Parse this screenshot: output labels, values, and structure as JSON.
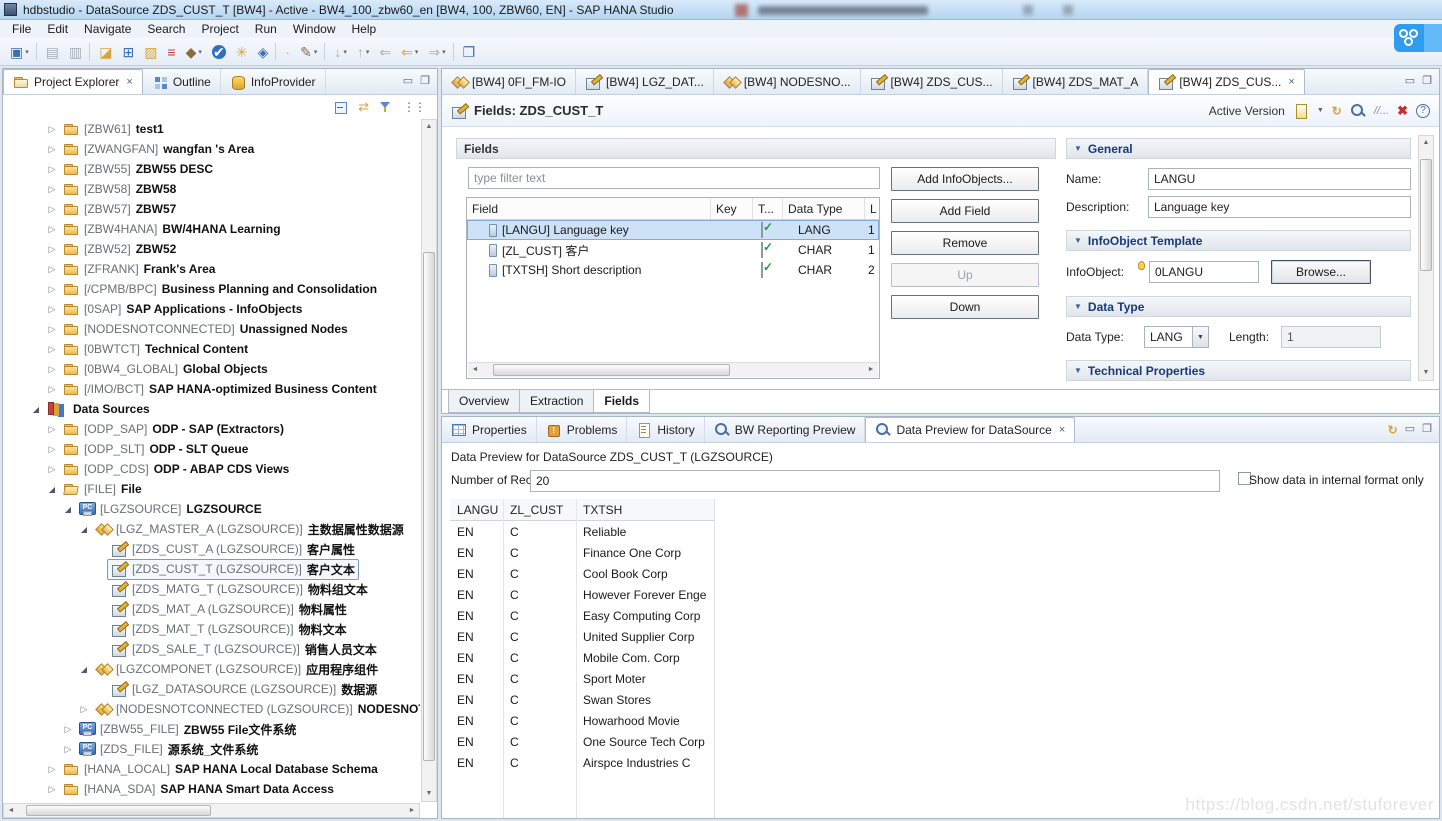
{
  "window": {
    "title": "hdbstudio - DataSource ZDS_CUST_T [BW4] - Active - BW4_100_zbw60_en [BW4, 100, ZBW60, EN] - SAP HANA Studio"
  },
  "menu": [
    "File",
    "Edit",
    "Navigate",
    "Search",
    "Project",
    "Run",
    "Window",
    "Help"
  ],
  "toolbar": [
    {
      "g": "▣",
      "c": "c-blue",
      "dd": "▾"
    },
    {
      "cls": "sep"
    },
    {
      "g": "▤",
      "c": "c-gray"
    },
    {
      "g": "▥",
      "c": "c-gray"
    },
    {
      "cls": "sep"
    },
    {
      "g": "◪",
      "c": "c-gold"
    },
    {
      "g": "⊞",
      "c": "c-blue"
    },
    {
      "g": "▨",
      "c": "c-gold"
    },
    {
      "g": "≡",
      "c": "c-red"
    },
    {
      "g": "◆",
      "c": "c-olive",
      "dd": "▾"
    },
    {
      "g": "✔",
      "c": "c-check"
    },
    {
      "g": "✳",
      "c": "c-gold"
    },
    {
      "g": "◈",
      "c": "c-blue"
    },
    {
      "cls": "sep"
    },
    {
      "g": "·",
      "c": "c-gray"
    },
    {
      "g": "✎",
      "c": "c-olive",
      "dd": "▾"
    },
    {
      "cls": "sep"
    },
    {
      "g": "↓",
      "c": "c-gray",
      "dd": "▾"
    },
    {
      "g": "↑",
      "c": "c-gray",
      "dd": "▾"
    },
    {
      "g": "⇐",
      "c": "c-gray"
    },
    {
      "g": "⇐",
      "c": "c-gold",
      "dd": "▾"
    },
    {
      "g": "⇒",
      "c": "c-gray",
      "dd": "▾"
    },
    {
      "cls": "sep"
    },
    {
      "g": "❐",
      "c": "c-blue"
    }
  ],
  "left_panel": {
    "tabs": [
      {
        "icon": "explorer",
        "label": "Project Explorer",
        "cls": "active",
        "close": "×"
      },
      {
        "icon": "outline",
        "label": "Outline"
      },
      {
        "icon": "infoprov",
        "label": "InfoProvider"
      }
    ],
    "tree": [
      {
        "id": "[ZBW61]",
        "label": "test1",
        "icon": "infoarea",
        "ar": "c",
        "lvl": 2
      },
      {
        "id": "[ZWANGFAN]",
        "label": "wangfan 's Area",
        "icon": "infoarea",
        "ar": "c",
        "lvl": 2
      },
      {
        "id": "[ZBW55]",
        "label": "ZBW55 DESC",
        "icon": "infoarea",
        "ar": "c",
        "lvl": 2
      },
      {
        "id": "[ZBW58]",
        "label": "ZBW58",
        "icon": "infoarea",
        "ar": "c",
        "lvl": 2
      },
      {
        "id": "[ZBW57]",
        "label": "ZBW57",
        "icon": "infoarea",
        "ar": "c",
        "lvl": 2
      },
      {
        "id": "[ZBW4HANA]",
        "label": "BW/4HANA Learning",
        "icon": "infoarea",
        "ar": "c",
        "lvl": 2
      },
      {
        "id": "[ZBW52]",
        "label": "ZBW52",
        "icon": "infoarea",
        "ar": "c",
        "lvl": 2
      },
      {
        "id": "[ZFRANK]",
        "label": "Frank's Area",
        "icon": "infoarea",
        "ar": "c",
        "lvl": 2
      },
      {
        "id": "[/CPMB/BPC]",
        "label": "Business Planning and Consolidation",
        "icon": "infoarea",
        "ar": "c",
        "lvl": 2
      },
      {
        "id": "[0SAP]",
        "label": "SAP Applications - InfoObjects",
        "icon": "infoarea",
        "ar": "c",
        "lvl": 2
      },
      {
        "id": "[NODESNOTCONNECTED]",
        "label": "Unassigned Nodes",
        "icon": "infoarea",
        "ar": "c",
        "lvl": 2
      },
      {
        "id": "[0BWTCT]",
        "label": "Technical Content",
        "icon": "infoarea",
        "ar": "c",
        "lvl": 2
      },
      {
        "id": "[0BW4_GLOBAL]",
        "label": "Global Objects",
        "icon": "infoarea",
        "ar": "c",
        "lvl": 2
      },
      {
        "id": "[/IMO/BCT]",
        "label": "SAP HANA-optimized Business Content",
        "icon": "infoarea",
        "ar": "c",
        "lvl": 2
      },
      {
        "id": "",
        "label": "Data Sources",
        "icon": "books",
        "ar": "e",
        "lvl": 1
      },
      {
        "id": "[ODP_SAP]",
        "label": "ODP - SAP (Extractors)",
        "icon": "folder",
        "ar": "c",
        "lvl": 2
      },
      {
        "id": "[ODP_SLT]",
        "label": "ODP - SLT Queue",
        "icon": "folder",
        "ar": "c",
        "lvl": 2
      },
      {
        "id": "[ODP_CDS]",
        "label": "ODP - ABAP CDS Views",
        "icon": "folder",
        "ar": "c",
        "lvl": 2
      },
      {
        "id": "[FILE]",
        "label": "File",
        "icon": "folderopen",
        "ar": "e",
        "lvl": 2
      },
      {
        "id": "[LGZSOURCE]",
        "label": "LGZSOURCE",
        "icon": "pc",
        "ar": "e",
        "lvl": 3
      },
      {
        "id": "[LGZ_MASTER_A (LGZSOURCE)]",
        "label": "主数据属性数据源",
        "icon": "diamond",
        "ar": "e",
        "lvl": 4
      },
      {
        "id": "[ZDS_CUST_A (LGZSOURCE)]",
        "label": "客户属性",
        "icon": "ds",
        "ar": "n",
        "lvl": 5
      },
      {
        "id": "[ZDS_CUST_T (LGZSOURCE)]",
        "label": "客户文本",
        "icon": "ds",
        "ar": "n",
        "lvl": 5,
        "sel": "sel"
      },
      {
        "id": "[ZDS_MATG_T (LGZSOURCE)]",
        "label": "物料组文本",
        "icon": "ds",
        "ar": "n",
        "lvl": 5
      },
      {
        "id": "[ZDS_MAT_A (LGZSOURCE)]",
        "label": "物料属性",
        "icon": "ds",
        "ar": "n",
        "lvl": 5
      },
      {
        "id": "[ZDS_MAT_T (LGZSOURCE)]",
        "label": "物料文本",
        "icon": "ds",
        "ar": "n",
        "lvl": 5
      },
      {
        "id": "[ZDS_SALE_T (LGZSOURCE)]",
        "label": "销售人员文本",
        "icon": "ds",
        "ar": "n",
        "lvl": 5
      },
      {
        "id": "[LGZCOMPONET (LGZSOURCE)]",
        "label": "应用程序组件",
        "icon": "diamond",
        "ar": "e",
        "lvl": 4
      },
      {
        "id": "[LGZ_DATASOURCE (LGZSOURCE)]",
        "label": "数据源",
        "icon": "ds",
        "ar": "n",
        "lvl": 5
      },
      {
        "id": "[NODESNOTCONNECTED (LGZSOURCE)]",
        "label": "NODESNOTCONNECTED",
        "icon": "diamond",
        "ar": "c",
        "lvl": 4
      },
      {
        "id": "[ZBW55_FILE]",
        "label": "ZBW55 File文件系统",
        "icon": "pc",
        "ar": "c",
        "lvl": 3
      },
      {
        "id": "[ZDS_FILE]",
        "label": "源系统_文件系统",
        "icon": "pc",
        "ar": "c",
        "lvl": 3
      },
      {
        "id": "[HANA_LOCAL]",
        "label": "SAP HANA Local Database Schema",
        "icon": "folder",
        "ar": "c",
        "lvl": 2
      },
      {
        "id": "[HANA_SDA]",
        "label": "SAP HANA Smart Data Access",
        "icon": "folder",
        "ar": "c",
        "lvl": 2
      }
    ]
  },
  "editor": {
    "tabs": [
      {
        "icon": "diamond",
        "label": "[BW4] 0FI_FM-IO"
      },
      {
        "icon": "ds",
        "label": "[BW4] LGZ_DAT..."
      },
      {
        "icon": "diamond",
        "label": "[BW4] NODESNO..."
      },
      {
        "icon": "ds",
        "label": "[BW4] ZDS_CUS..."
      },
      {
        "icon": "ds",
        "label": "[BW4] ZDS_MAT_A"
      },
      {
        "icon": "ds",
        "label": "[BW4] ZDS_CUS...",
        "cls": "active",
        "close": "×"
      }
    ],
    "header": {
      "title": "Fields: ZDS_CUST_T",
      "active_version": "Active Version"
    },
    "fields_section": {
      "title": "Fields",
      "filter_placeholder": "type filter text",
      "columns": [
        "Field",
        "Key",
        "T...",
        "Data Type",
        "L"
      ],
      "rows": [
        {
          "field": "[LANGU] Language key",
          "type": "LANG",
          "len": "1",
          "sel": "sel"
        },
        {
          "field": "[ZL_CUST] 客户",
          "type": "CHAR",
          "len": "1"
        },
        {
          "field": "[TXTSH] Short description",
          "type": "CHAR",
          "len": "2"
        }
      ],
      "buttons": [
        {
          "label": "Add InfoObjects..."
        },
        {
          "label": "Add Field"
        },
        {
          "label": "Remove"
        },
        {
          "label": "Up",
          "cls": "dis"
        },
        {
          "label": "Down"
        }
      ]
    },
    "properties": {
      "general_title": "General",
      "name_label": "Name:",
      "name_value": "LANGU",
      "desc_label": "Description:",
      "desc_value": "Language key",
      "template_title": "InfoObject Template",
      "infoobject_label": "InfoObject:",
      "infoobject_value": "0LANGU",
      "browse_label": "Browse...",
      "datatype_title": "Data Type",
      "datatype_label": "Data Type:",
      "datatype_value": "LANG",
      "length_label": "Length:",
      "length_value": "1",
      "technical_title": "Technical Properties"
    },
    "page_tabs": [
      {
        "label": "Overview"
      },
      {
        "label": "Extraction"
      },
      {
        "label": "Fields",
        "cls": "active"
      }
    ]
  },
  "bottom_panel": {
    "tabs": [
      {
        "icon": "properties",
        "label": "Properties"
      },
      {
        "icon": "problems",
        "label": "Problems"
      },
      {
        "icon": "history",
        "label": "History"
      },
      {
        "icon": "mag",
        "label": "BW Reporting Preview"
      },
      {
        "icon": "mag",
        "label": "Data Preview for DataSource",
        "cls": "active",
        "close": "×"
      }
    ],
    "preview_title": "Data Preview for DataSource ZDS_CUST_T (LGZSOURCE)",
    "records_label": "Number of Records:",
    "records_value": "20",
    "internal_label": "Show data in internal format only",
    "table": {
      "columns": [
        "LANGU",
        "ZL_CUST",
        "TXTSH"
      ],
      "rows": [
        [
          "EN",
          "C",
          "Reliable"
        ],
        [
          "EN",
          "C",
          "Finance One Corp"
        ],
        [
          "EN",
          "C",
          "Cool Book Corp"
        ],
        [
          "EN",
          "C",
          "However Forever Enge"
        ],
        [
          "EN",
          "C",
          "Easy Computing Corp"
        ],
        [
          "EN",
          "C",
          "United Supplier Corp"
        ],
        [
          "EN",
          "C",
          "Mobile Com. Corp"
        ],
        [
          "EN",
          "C",
          "Sport Moter"
        ],
        [
          "EN",
          "C",
          "Swan Stores"
        ],
        [
          "EN",
          "C",
          "Howarhood Movie"
        ],
        [
          "EN",
          "C",
          "One Source Tech Corp"
        ],
        [
          "EN",
          "C",
          "Airspce Industries C"
        ]
      ]
    }
  },
  "watermark": "https://blog.csdn.net/stuforever"
}
